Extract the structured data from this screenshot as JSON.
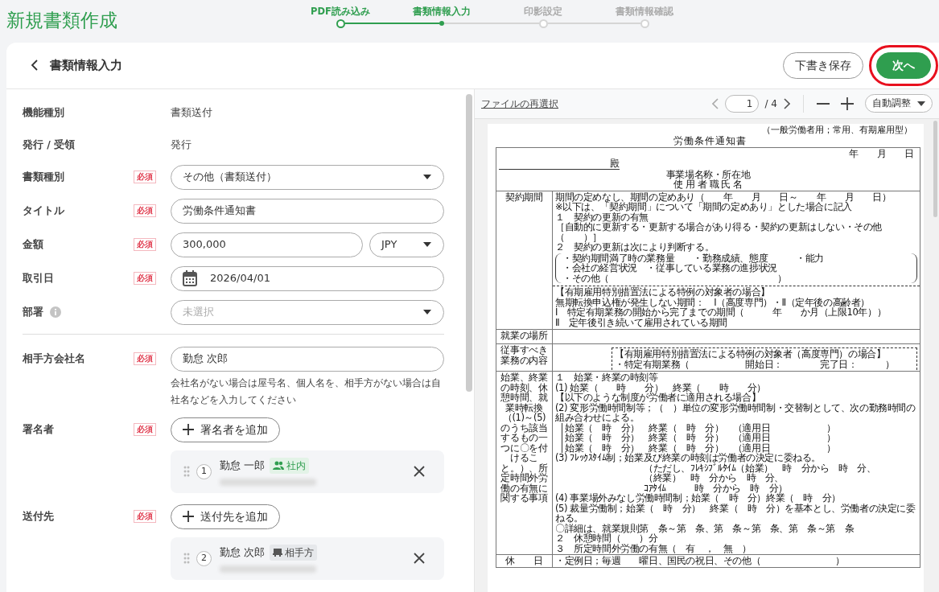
{
  "app_title": "新規書類作成",
  "steps": [
    {
      "label": "PDF読み込み",
      "selected": false,
      "completed": true
    },
    {
      "label": "書類情報入力",
      "selected": true,
      "completed": false
    },
    {
      "label": "印影設定",
      "selected": false,
      "completed": false
    },
    {
      "label": "書類情報確認",
      "selected": false,
      "completed": false
    }
  ],
  "header": {
    "title": "書類情報入力",
    "buttons": [
      {
        "label": "下書き保存",
        "kind": "outline",
        "highlighted": false
      },
      {
        "label": "次へ",
        "kind": "primary",
        "highlighted": true
      }
    ]
  },
  "info_rows": [
    {
      "label": "機能種別",
      "value": "書類送付"
    },
    {
      "label": "発行 / 受領",
      "value": "発行"
    }
  ],
  "field_groups": [
    [
      {
        "label": "書類種別",
        "badge": "必須",
        "kind": "select",
        "value": "その他（書類送付）"
      },
      {
        "label": "タイトル",
        "badge": "必須",
        "kind": "text",
        "value": "労働条件通知書"
      },
      {
        "label": "金額",
        "badge": "必須",
        "kind": "amount",
        "value": "300,000",
        "currency": "JPY"
      },
      {
        "label": "取引日",
        "badge": "必須",
        "kind": "date",
        "value": "2026/04/01"
      },
      {
        "label": "部署",
        "info": true,
        "kind": "select",
        "placeholder": "未選択"
      }
    ],
    [
      {
        "label": "相手方会社名",
        "badge": "必須",
        "kind": "text",
        "value": "勤怠 次郎",
        "help": "会社名がない場合は屋号名、個人名を、相手方がない場合は自社名などを入力してください"
      },
      {
        "label": "署名者",
        "badge": "必須",
        "kind": "people",
        "add_label": "署名者を追加",
        "people": [
          {
            "number": "1",
            "name": "勤怠 一郎",
            "tag": "社内",
            "internal": true
          }
        ]
      },
      {
        "label": "送付先",
        "badge": "必須",
        "kind": "people",
        "add_label": "送付先を追加",
        "people": [
          {
            "number": "2",
            "name": "勤怠 次郎",
            "tag": "相手方",
            "internal": false
          }
        ]
      }
    ]
  ],
  "viewer": {
    "reselect_link": "ファイルの再選択",
    "page": "1",
    "page_total": "/ 4",
    "zoom": "自動調整"
  },
  "document": {
    "note": "（一般労働者用；常用、有期雇用型）",
    "title": "労働条件通知書",
    "date_line": "年　　月　　日",
    "addressee": "殿",
    "employer_lines": [
      "事業場名称・所在地",
      "使 用 者 職 氏 名"
    ],
    "rows": [
      {
        "label": "契約期間",
        "blocks": [
          {
            "kind": "text",
            "lines": [
              "期間の定めなし、期間の定めあり（　　年　　月　　日～　　年　　月　　日）",
              "※以下は、「契約期間」について「期間の定めあり」とした場合に記入",
              "１　契約の更新の有無",
              "［自動的に更新する・更新する場合があり得る・契約の更新はしない・その他（　　）］",
              "２　契約の更新は次により判断する。"
            ]
          },
          {
            "kind": "bracket",
            "lines": [
              "・契約期間満了時の業務量　　・勤務成績、態度　　　・能力",
              "・会社の経営状況　・従事している業務の進捗状況",
              "・その他（　　　　　　　　　　　　　　　　　　）"
            ]
          },
          {
            "kind": "dashed",
            "lines": [
              "【有期雇用特別措置法による特例の対象者の場合】",
              "無期転換申込権が発生しない期間：　Ⅰ（高度専門）・Ⅱ（定年後の高齢者）",
              "Ⅰ　特定有期業務の開始から完了までの期間（　　　年　　か月（上限10年））",
              "Ⅱ　定年後引き続いて雇用されている期間"
            ]
          }
        ]
      },
      {
        "label": "就業の場所",
        "blocks": []
      },
      {
        "label": "従事すべき業務の内容",
        "blocks": [
          {
            "kind": "dashed",
            "lines": [
              "【有期雇用特別措置法による特例の対象者（高度専門）の場合】",
              "・特定有期業務（　　　　　　開始日：　　　　完了日：　　　）"
            ]
          }
        ]
      },
      {
        "label": "始業、終業の時刻、休憩時間、就業時転換（(1)～(5)のうち該当するもの一つに〇を付けること。）、所定時間外労働の有無に関する事項",
        "blocks": [
          {
            "kind": "text",
            "lines": [
              "１　始業・終業の時刻等",
              "(1) 始業（　　時　　分）　終業（　　時　　分）",
              "【以下のような制度が労働者に適用される場合】",
              "(2) 変形労働時間制等；（　）単位の変形労働時間制・交替制として、次の勤務時間の組み合わせによる。"
            ]
          },
          {
            "kind": "left_bracket",
            "lines": [
              "始業（　時　分）　終業（　時　分）　（適用日　　　　　　）",
              "始業（　時　分）　終業（　時　分）　（適用日　　　　　　）",
              "始業（　時　分）　終業（　時　分）　（適用日　　　　　　）"
            ]
          },
          {
            "kind": "text",
            "lines": [
              "(3) ﾌﾚｯｸｽﾀｲﾑ制；始業及び終業の時刻は労働者の決定に委ねる。"
            ]
          },
          {
            "kind": "indented",
            "lines": [
              "（ただし、ﾌﾚｷｼﾌﾞﾙﾀｲﾑ（始業）　時　分から　時　分、",
              "（終業）　時　分から　時　分、",
              "ｺｱﾀｲﾑ　　　時　分から　時　分）"
            ]
          },
          {
            "kind": "text",
            "lines": [
              "(4) 事業場外みなし労働時間制；始業（　時　分）終業（　時　分）",
              "(5) 裁量労働制；始業（　時　分）　終業（　時　分）を基本とし、労働者の決定に委ねる。",
              "〇詳細は、就業規則第　条～第　条、第　条～第　条、第　条～第　条",
              "２　休憩時間（　　）分",
              "３　所定時間外労働の有無（　有　，　無　）"
            ]
          }
        ]
      },
      {
        "label": "休　　日",
        "blocks": [
          {
            "kind": "text",
            "lines": [
              "・定例日；毎週　　曜日、国民の祝日、その他（　　　　　　　　）"
            ]
          }
        ]
      }
    ]
  }
}
